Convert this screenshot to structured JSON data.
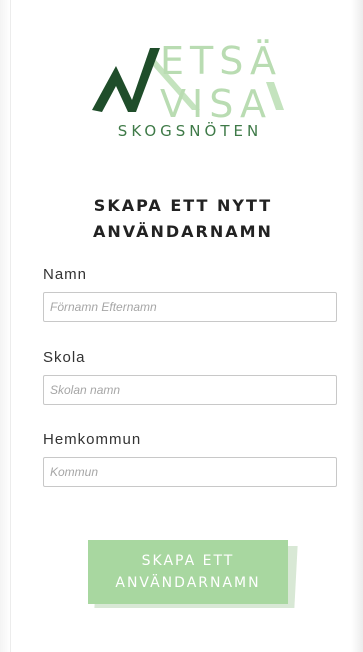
{
  "logo": {
    "word1": "ETSÄ",
    "word2": "VISA",
    "subtitle": "SKOGSNÖTEN"
  },
  "title": {
    "line1": "SKAPA ETT NYTT",
    "line2": "ANVÄNDARNAMN"
  },
  "form": {
    "name_label": "Namn",
    "name_placeholder": "Förnamn Efternamn",
    "school_label": "Skola",
    "school_placeholder": "Skolan namn",
    "municipality_label": "Hemkommun",
    "municipality_placeholder": "Kommun"
  },
  "submit": {
    "line1": "SKAPA ETT",
    "line2": "ANVÄNDARNAMN"
  },
  "colors": {
    "logo_dark_green": "#1f4d2a",
    "logo_light_green": "#b9dcb2",
    "button_green": "#a8d7a0"
  }
}
